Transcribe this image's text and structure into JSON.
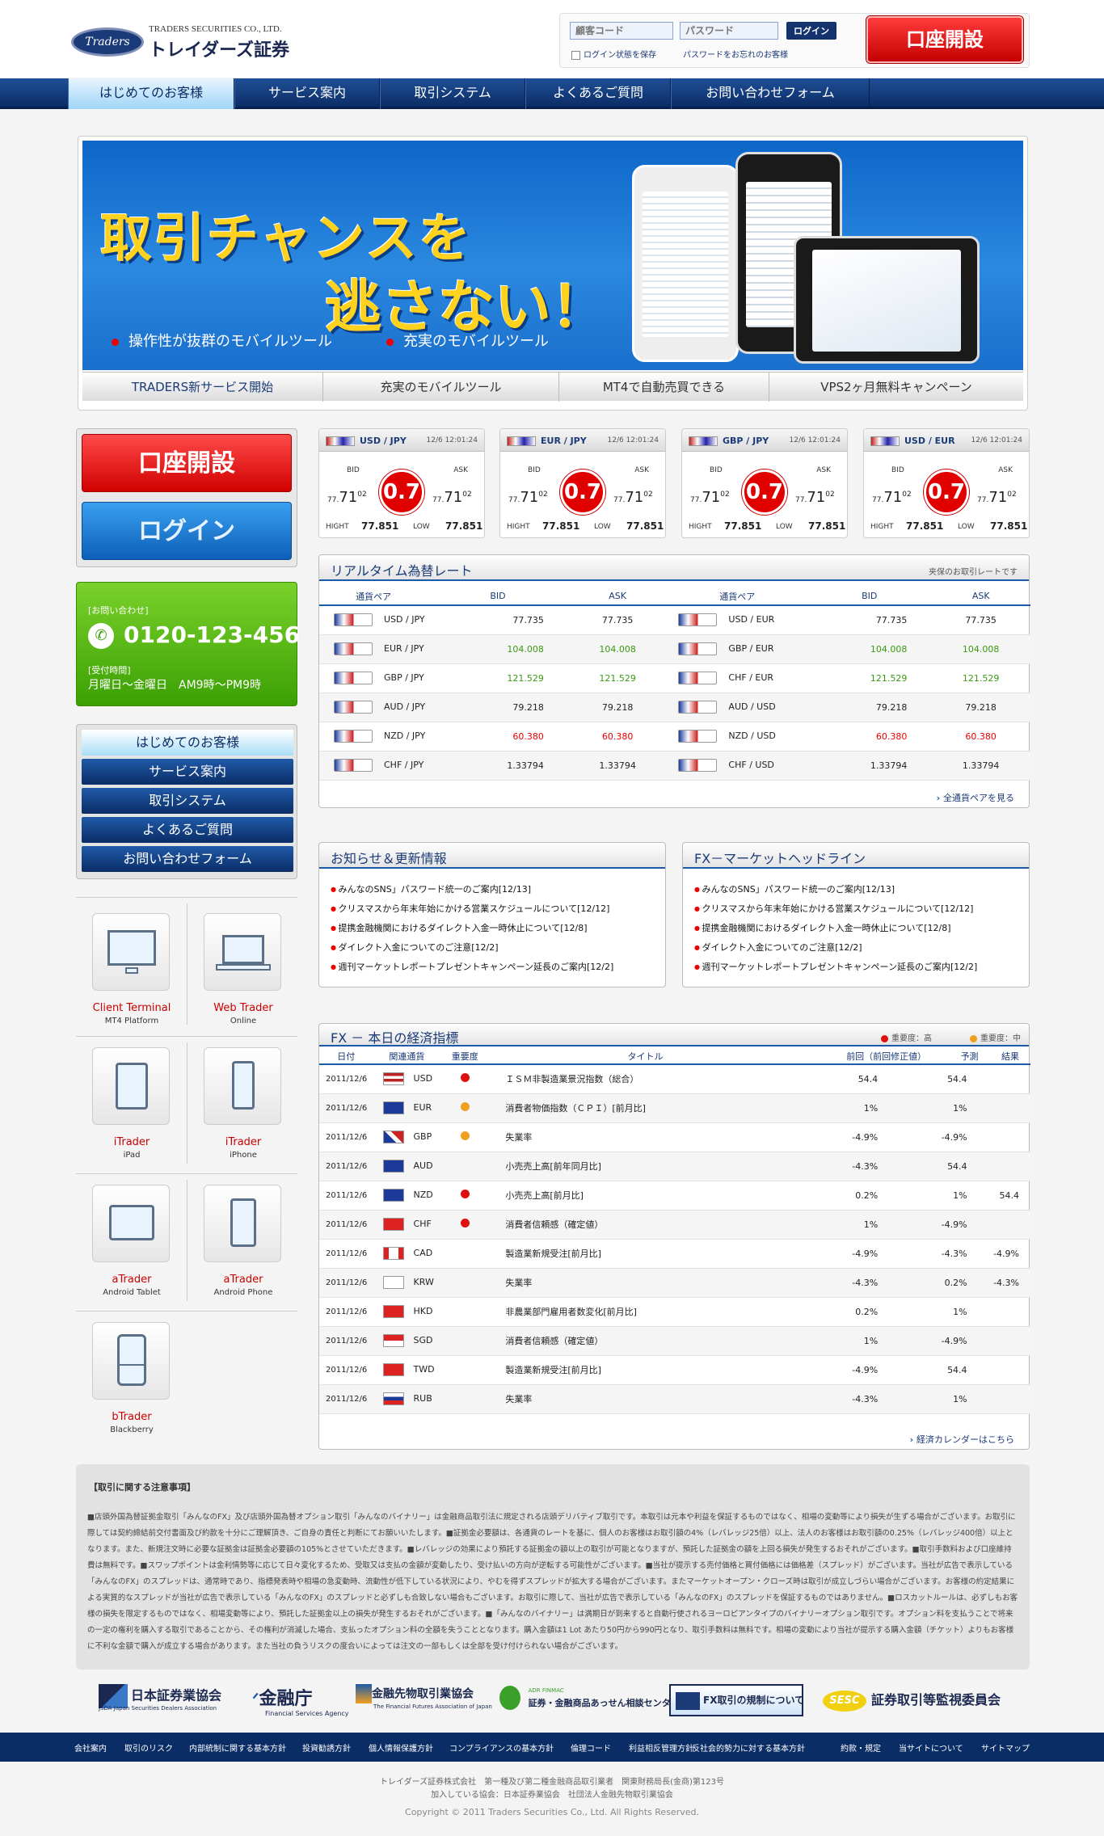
{
  "header": {
    "logo_mark": "Traders",
    "company_en": "TRADERS SECURITIES CO., LTD.",
    "company_jp": "トレイダーズ証券",
    "login": {
      "id_placeholder": "顧客コード",
      "pw_placeholder": "パスワード",
      "button": "ログイン",
      "keep_login": "ログイン状態を保存",
      "forgot": "パスワードをお忘れのお客様"
    },
    "open_account": "口座開設"
  },
  "nav": [
    "はじめてのお客様",
    "サービス案内",
    "取引システム",
    "よくあるご質問",
    "お問い合わせフォーム"
  ],
  "hero": {
    "title_line1": "取引チャンスを",
    "title_line2": "逃さない！",
    "bullets": [
      "操作性が抜群のモバイルツール",
      "充実のモバイルツール"
    ],
    "tabs": [
      "TRADERS新サービス開始",
      "充実のモバイルツール",
      "MT4で自動売買できる",
      "VPS2ヶ月無料キャンペーン"
    ]
  },
  "left": {
    "open_account": "口座開設",
    "login": "ログイン",
    "contact": {
      "head": "[お問い合わせ]",
      "phone": "0120-123-456",
      "sub": "[受付時間]",
      "hours": "月曜日～金曜日　AM9時～PM9時"
    },
    "sidenav": [
      "はじめてのお客様",
      "サービス案内",
      "取引システム",
      "よくあるご質問",
      "お問い合わせフォーム"
    ],
    "tools": [
      {
        "name": "Client Terminal",
        "sub": "MT4 Platform"
      },
      {
        "name": "Web Trader",
        "sub": "Online"
      },
      {
        "name": "iTrader",
        "sub": "iPad"
      },
      {
        "name": "iTrader",
        "sub": "iPhone"
      },
      {
        "name": "aTrader",
        "sub": "Android Tablet"
      },
      {
        "name": "aTrader",
        "sub": "Android Phone"
      },
      {
        "name": "bTrader",
        "sub": "Blackberry"
      }
    ]
  },
  "quotes": [
    {
      "pair": "USD / JPY",
      "time": "12/6 12:01:24",
      "bid_label": "BID",
      "ask_label": "ASK",
      "bid_small": "77.",
      "bid": "71",
      "bid_sup": "02",
      "ask_small": "77.",
      "ask": "71",
      "ask_sup": "02",
      "spread": "0.7",
      "high_label": "HIGHT",
      "high": "77.851",
      "low_label": "LOW",
      "low": "77.851"
    },
    {
      "pair": "EUR / JPY",
      "time": "12/6 12:01:24",
      "bid_label": "BID",
      "ask_label": "ASK",
      "bid_small": "77.",
      "bid": "71",
      "bid_sup": "02",
      "ask_small": "77.",
      "ask": "71",
      "ask_sup": "02",
      "spread": "0.7",
      "high_label": "HIGHT",
      "high": "77.851",
      "low_label": "LOW",
      "low": "77.851"
    },
    {
      "pair": "GBP / JPY",
      "time": "12/6 12:01:24",
      "bid_label": "BID",
      "ask_label": "ASK",
      "bid_small": "77.",
      "bid": "71",
      "bid_sup": "02",
      "ask_small": "77.",
      "ask": "71",
      "ask_sup": "02",
      "spread": "0.7",
      "high_label": "HIGHT",
      "high": "77.851",
      "low_label": "LOW",
      "low": "77.851"
    },
    {
      "pair": "USD / EUR",
      "time": "12/6 12:01:24",
      "bid_label": "BID",
      "ask_label": "ASK",
      "bid_small": "77.",
      "bid": "71",
      "bid_sup": "02",
      "ask_small": "77.",
      "ask": "71",
      "ask_sup": "02",
      "spread": "0.7",
      "high_label": "HIGHT",
      "high": "77.851",
      "low_label": "LOW",
      "low": "77.851"
    }
  ],
  "rates": {
    "title": "リアルタイム為替レート",
    "note": "夹保のお取引レートです",
    "headers": [
      "通貨ペア",
      "BID",
      "ASK",
      "通貨ペア",
      "BID",
      "ASK"
    ],
    "rows": [
      {
        "p1": "USD / JPY",
        "b1": "77.735",
        "a1": "77.735",
        "c1": "",
        "p2": "USD / EUR",
        "b2": "77.735",
        "a2": "77.735",
        "c2": ""
      },
      {
        "p1": "EUR / JPY",
        "b1": "104.008",
        "a1": "104.008",
        "c1": "grn",
        "p2": "GBP / EUR",
        "b2": "104.008",
        "a2": "104.008",
        "c2": "grn"
      },
      {
        "p1": "GBP / JPY",
        "b1": "121.529",
        "a1": "121.529",
        "c1": "grn",
        "p2": "CHF / EUR",
        "b2": "121.529",
        "a2": "121.529",
        "c2": "grn"
      },
      {
        "p1": "AUD / JPY",
        "b1": "79.218",
        "a1": "79.218",
        "c1": "",
        "p2": "AUD / USD",
        "b2": "79.218",
        "a2": "79.218",
        "c2": ""
      },
      {
        "p1": "NZD / JPY",
        "b1": "60.380",
        "a1": "60.380",
        "c1": "red",
        "p2": "NZD / USD",
        "b2": "60.380",
        "a2": "60.380",
        "c2": "red"
      },
      {
        "p1": "CHF / JPY",
        "b1": "1.33794",
        "a1": "1.33794",
        "c1": "",
        "p2": "CHF / USD",
        "b2": "1.33794",
        "a2": "1.33794",
        "c2": ""
      }
    ],
    "more": "全通貨ペアを見る"
  },
  "news": {
    "title": "お知らせ＆更新情報",
    "items": [
      "みんなのSNS」パスワード統一のご案内[12/13]",
      "クリスマスから年末年始にかける営業スケジュールについて[12/12]",
      "提携金融機関におけるダイレクト入金一時休止について[12/8]",
      "ダイレクト入金についてのご注意[12/2]",
      "週刊マーケットレポートプレゼントキャンペーン延長のご案内[12/2]"
    ]
  },
  "headlines": {
    "title": "FX－マーケットヘッドライン",
    "items": [
      "みんなのSNS」パスワード統一のご案内[12/13]",
      "クリスマスから年末年始にかける営業スケジュールについて[12/12]",
      "提携金融機関におけるダイレクト入金一時休止について[12/8]",
      "ダイレクト入金についてのご注意[12/2]",
      "週刊マーケットレポートプレゼントキャンペーン延長のご案内[12/2]"
    ]
  },
  "calendar": {
    "title": "FX － 本日の経済指標",
    "legend_high": "重要度：高",
    "legend_mid": "重要度：中",
    "colors": {
      "high": "#e01010",
      "mid": "#f0a020"
    },
    "headers": [
      "日付",
      "関連通貨",
      "重要度",
      "タイトル",
      "前回（前回修正値）",
      "予測",
      "結果"
    ],
    "rows": [
      {
        "date": "2011/12/6",
        "cur": "USD",
        "imp": "high",
        "title": "ＩＳＭ非製造業景況指数（総合）",
        "prev": "54.4",
        "fc": "54.4",
        "res": ""
      },
      {
        "date": "2011/12/6",
        "cur": "EUR",
        "imp": "mid",
        "title": "消費者物価指数（ＣＰＩ）[前月比]",
        "prev": "1%",
        "fc": "1%",
        "res": ""
      },
      {
        "date": "2011/12/6",
        "cur": "GBP",
        "imp": "mid",
        "title": "失業率",
        "prev": "-4.9%",
        "fc": "-4.9%",
        "res": ""
      },
      {
        "date": "2011/12/6",
        "cur": "AUD",
        "imp": "",
        "title": "小売売上高[前年同月比]",
        "prev": "-4.3%",
        "fc": "54.4",
        "res": ""
      },
      {
        "date": "2011/12/6",
        "cur": "NZD",
        "imp": "high",
        "title": "小売売上高[前月比]",
        "prev": "0.2%",
        "fc": "1%",
        "res": "54.4"
      },
      {
        "date": "2011/12/6",
        "cur": "CHF",
        "imp": "high",
        "title": "消費者信頼感（確定値）",
        "prev": "1%",
        "fc": "-4.9%",
        "res": ""
      },
      {
        "date": "2011/12/6",
        "cur": "CAD",
        "imp": "",
        "title": "製造業新規受注[前月比]",
        "prev": "-4.9%",
        "fc": "-4.3%",
        "res": "-4.9%"
      },
      {
        "date": "2011/12/6",
        "cur": "KRW",
        "imp": "",
        "title": "失業率",
        "prev": "-4.3%",
        "fc": "0.2%",
        "res": "-4.3%"
      },
      {
        "date": "2011/12/6",
        "cur": "HKD",
        "imp": "",
        "title": "非農業部門雇用者数変化[前月比]",
        "prev": "0.2%",
        "fc": "1%",
        "res": ""
      },
      {
        "date": "2011/12/6",
        "cur": "SGD",
        "imp": "",
        "title": "消費者信頼感（確定値）",
        "prev": "1%",
        "fc": "-4.9%",
        "res": ""
      },
      {
        "date": "2011/12/6",
        "cur": "TWD",
        "imp": "",
        "title": "製造業新規受注[前月比]",
        "prev": "-4.9%",
        "fc": "54.4",
        "res": ""
      },
      {
        "date": "2011/12/6",
        "cur": "RUB",
        "imp": "",
        "title": "失業率",
        "prev": "-4.3%",
        "fc": "1%",
        "res": ""
      }
    ],
    "more": "経済カレンダーはこちら"
  },
  "disclaimer": {
    "title": "【取引に関する注意事項】",
    "body": "■店頭外国為替証拠金取引「みんなのFX」及び店頭外国為替オプション取引「みんなのバイナリー」は金融商品取引法に規定される店頭デリバティブ取引です。本取引は元本や利益を保証するものではなく、相場の変動等により損失が生ずる場合がございます。お取引に際しては契約締結前交付書面及び約款を十分にご理解頂き、ご自身の責任と判断にてお願いいたします。■証拠金必要額は、各通貨のレートを基に、個人のお客様はお取引額の4%（レバレッジ25倍）以上、法人のお客様はお取引額の0.25%（レバレッジ400倍）以上となります。また、新規注文時に必要な証拠金は証拠金必要額の105%とさせていただきます。■レバレッジの効果により預託する証拠金の額以上の取引が可能となりますが、預託した証拠金の額を上回る損失が発生するおそれがございます。■取引手数料および口座維持費は無料です。■スワップポイントは金利情勢等に応じて日々変化するため、受取又は支払の金額が変動したり、受け払いの方向が逆転する可能性がございます。■当社が提示する売付価格と買付価格には価格差（スプレッド）がございます。当社が広告で表示している「みんなのFX」のスプレッドは、通常時であり、指標発表時や相場の急変動時、流動性が低下している状況により、やむを得ずスプレッドが拡大する場合がございます。またマーケットオープン・クローズ時は取引が成立しづらい場合がございます。お客様の約定結果による実質的なスプレッドが当社が広告で表示している「みんなのFX」のスプレッドと必ずしも合致しない場合もございます。お取引に際して、当社が広告で表示している「みんなのFX」のスプレッドを保証するものではありません。■ロスカットルールは、必ずしもお客様の損失を限定するものではなく、相場変動等により、預託した証拠金以上の損失が発生するおそれがございます。■「みんなのバイナリー」は満期日が到来すると自動行使されるヨーロピアンタイプのバイナリーオプション取引です。オプション料を支払うことで将来の一定の権利を購入する取引であることから、その権利が消滅した場合、支払ったオプション料の全額を失うこととなります。購入金額は1 Lot あたり50円から990円となり、取引手数料は無料です。相場の変動により当社が提示する購入金額（チケット）よりもお客様に不利な金額で購入が成立する場合があります。また当社の負うリスクの度合いによっては注文の一部もしくは全部を受け付けられない場合がございます。"
  },
  "org_logos": [
    "日本証券業協会",
    "金融庁",
    "金融先物取引業協会",
    "証券・金融商品あっせん相談センター",
    "FX取引の規制について",
    "証券取引等監視委員会"
  ],
  "org_logo_subs": [
    "JSDA  Japan Securities Dealers Association",
    "Financial Services Agency",
    "The Financial Futures Association of Japan",
    "ADR FINMAC"
  ],
  "footer_nav": [
    "会社案内",
    "取引のリスク",
    "内部統制に関する基本方針",
    "投資勧誘方針",
    "個人情報保護方針",
    "コンプライアンスの基本方針",
    "倫理コード",
    "利益相反管理方針",
    "反社会的勢力に対する基本方針",
    "約款・規定",
    "当サイトについて",
    "サイトマップ"
  ],
  "footer": {
    "line1": "トレイダーズ証券株式会社　第一種及び第二種金融商品取引業者　関東財務局長(金商)第123号",
    "line2": "加入している協会：日本証券業協会　社団法人金融先物取引業協会",
    "copyright": "Copyright © 2011 Traders Securities Co., Ltd. All Rights Reserved."
  }
}
